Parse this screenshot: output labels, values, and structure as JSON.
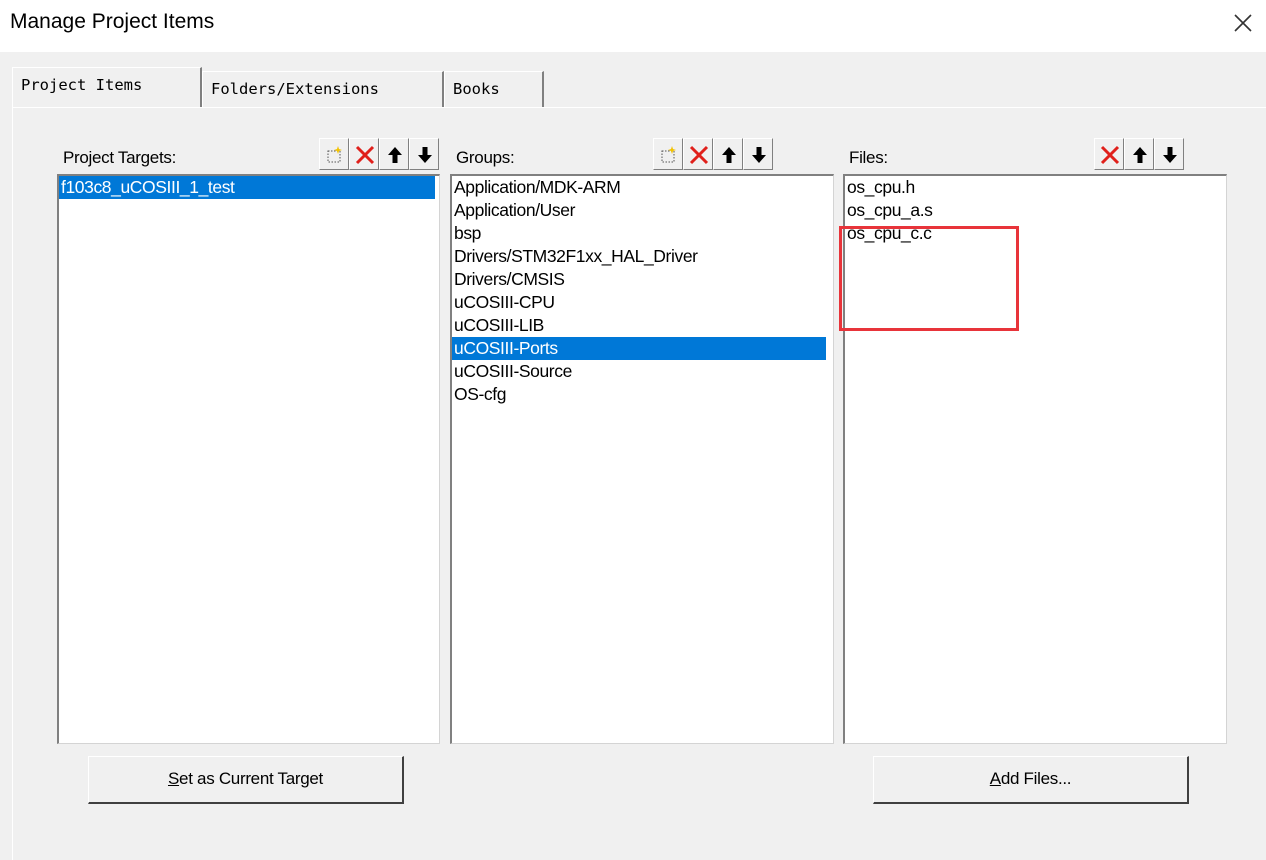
{
  "dialog": {
    "title": "Manage Project Items",
    "close_icon": "close-icon"
  },
  "tabs": [
    {
      "label": "Project Items",
      "active": true
    },
    {
      "label": "Folders/Extensions",
      "active": false
    },
    {
      "label": "Books",
      "active": false
    }
  ],
  "targets": {
    "label": "Project Targets:",
    "items": [
      "f103c8_uCOSIII_1_test"
    ],
    "selected": "f103c8_uCOSIII_1_test",
    "toolbar_icons": [
      "new-icon",
      "delete-icon",
      "move-up-icon",
      "move-down-icon"
    ]
  },
  "groups": {
    "label": "Groups:",
    "items": [
      "Application/MDK-ARM",
      "Application/User",
      "bsp",
      "Drivers/STM32F1xx_HAL_Driver",
      "Drivers/CMSIS",
      "uCOSIII-CPU",
      "uCOSIII-LIB",
      "uCOSIII-Ports",
      "uCOSIII-Source",
      "OS-cfg"
    ],
    "selected": "uCOSIII-Ports",
    "toolbar_icons": [
      "new-icon",
      "delete-icon",
      "move-up-icon",
      "move-down-icon"
    ]
  },
  "files": {
    "label": "Files:",
    "items": [
      "os_cpu.h",
      "os_cpu_a.s",
      "os_cpu_c.c"
    ],
    "toolbar_icons": [
      "delete-icon",
      "move-up-icon",
      "move-down-icon"
    ]
  },
  "buttons": {
    "set_target": {
      "accel": "S",
      "rest": "et as Current Target"
    },
    "add_files": {
      "accel": "A",
      "rest": "dd Files..."
    }
  },
  "colors": {
    "selection": "#0078d7",
    "highlight_box": "#e8343a",
    "dialog_bg": "#f0f0f0",
    "delete_icon": "#e0201b"
  }
}
